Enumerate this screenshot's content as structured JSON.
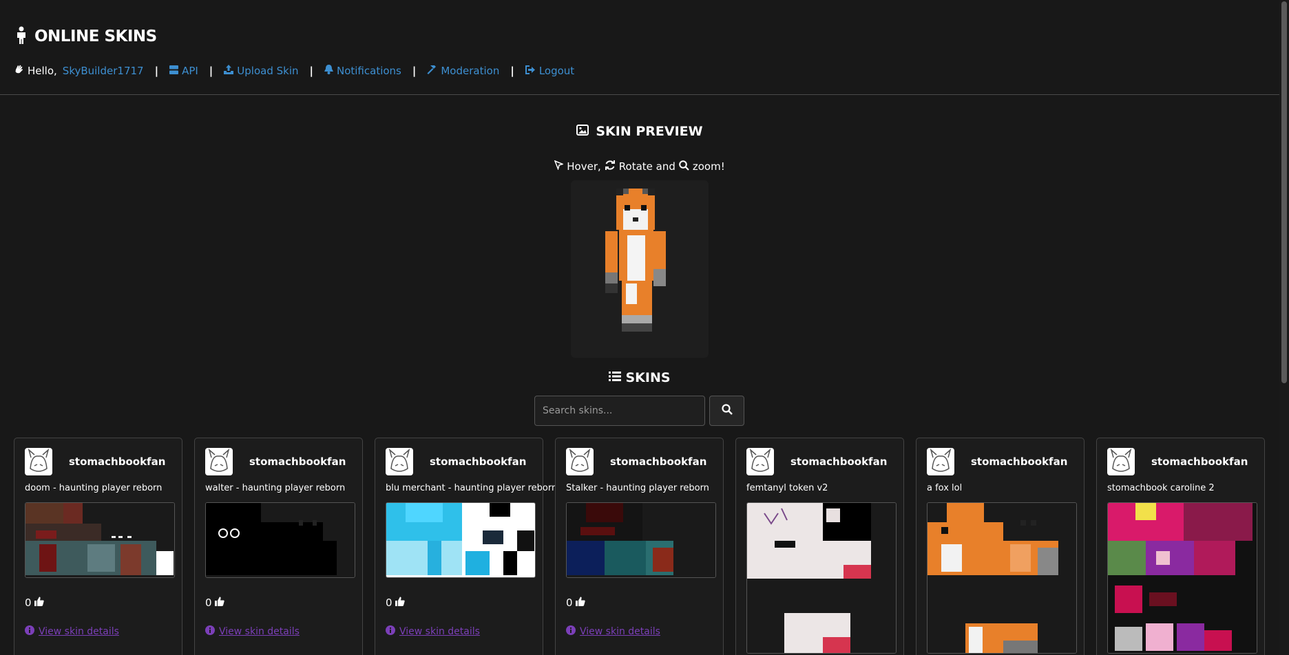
{
  "header": {
    "title": "ONLINE SKINS",
    "hello": "Hello,",
    "username": "SkyBuilder1717",
    "nav": [
      {
        "label": "API",
        "icon": "server-icon"
      },
      {
        "label": "Upload Skin",
        "icon": "upload-icon"
      },
      {
        "label": "Notifications",
        "icon": "bell-icon"
      },
      {
        "label": "Moderation",
        "icon": "hammer-icon"
      },
      {
        "label": "Logout",
        "icon": "logout-icon"
      }
    ]
  },
  "preview": {
    "title": "SKIN PREVIEW",
    "hint_hover": "Hover,",
    "hint_rotate": "Rotate and",
    "hint_zoom": "zoom!"
  },
  "skins": {
    "title": "SKINS",
    "search_placeholder": "Search skins...",
    "details_label": "View skin details",
    "cards": [
      {
        "author": "stomachbookfan",
        "name": "doom - haunting player reborn",
        "likes": "0"
      },
      {
        "author": "stomachbookfan",
        "name": "walter - haunting player reborn",
        "likes": "0"
      },
      {
        "author": "stomachbookfan",
        "name": "blu merchant - haunting player reborn",
        "likes": "0"
      },
      {
        "author": "stomachbookfan",
        "name": "Stalker - haunting player reborn",
        "likes": "0"
      },
      {
        "author": "stomachbookfan",
        "name": "femtanyl token v2",
        "likes": ""
      },
      {
        "author": "stomachbookfan",
        "name": "a fox lol",
        "likes": ""
      },
      {
        "author": "stomachbookfan",
        "name": "stomachbook caroline 2",
        "likes": ""
      }
    ]
  },
  "colors": {
    "background": "#181818",
    "link": "#3d8fd1",
    "details_link": "#7b3fb8"
  }
}
